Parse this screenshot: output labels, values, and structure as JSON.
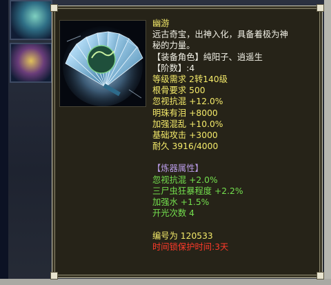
{
  "item": {
    "name": "幽游",
    "desc_line1": "远古奇宝，出神入化，具备着极为神",
    "desc_line2": "秘的力量。",
    "role": "【装备角色】纯阳子、逍遥生",
    "tier": "【阶数】:4",
    "stats": [
      {
        "label": "等级需求",
        "value": "2转140级"
      },
      {
        "label": "根骨要求",
        "value": "500"
      },
      {
        "label": "忽视抗混",
        "value": "+12.0%"
      },
      {
        "label": "明珠有泪",
        "value": "+8000"
      },
      {
        "label": "加强混乱",
        "value": "+10.0%"
      },
      {
        "label": "基础攻击",
        "value": "+3000"
      },
      {
        "label": "耐久",
        "value": "3916/4000"
      }
    ],
    "refine_header": "【炼器属性】",
    "refine": [
      "忽视抗混 +2.0%",
      "三尸虫狂暴程度 +2.2%",
      "加强水 +1.5%",
      "开光次数 4"
    ],
    "serial": "编号为 120533",
    "lock_label": "时间锁保护时间:",
    "lock_value": "3天"
  },
  "colors": {
    "white": "#f1f0e6",
    "yellow": "#f4ea6a",
    "purple": "#b99be6",
    "green": "#74e04e",
    "red": "#ff3a2a"
  }
}
